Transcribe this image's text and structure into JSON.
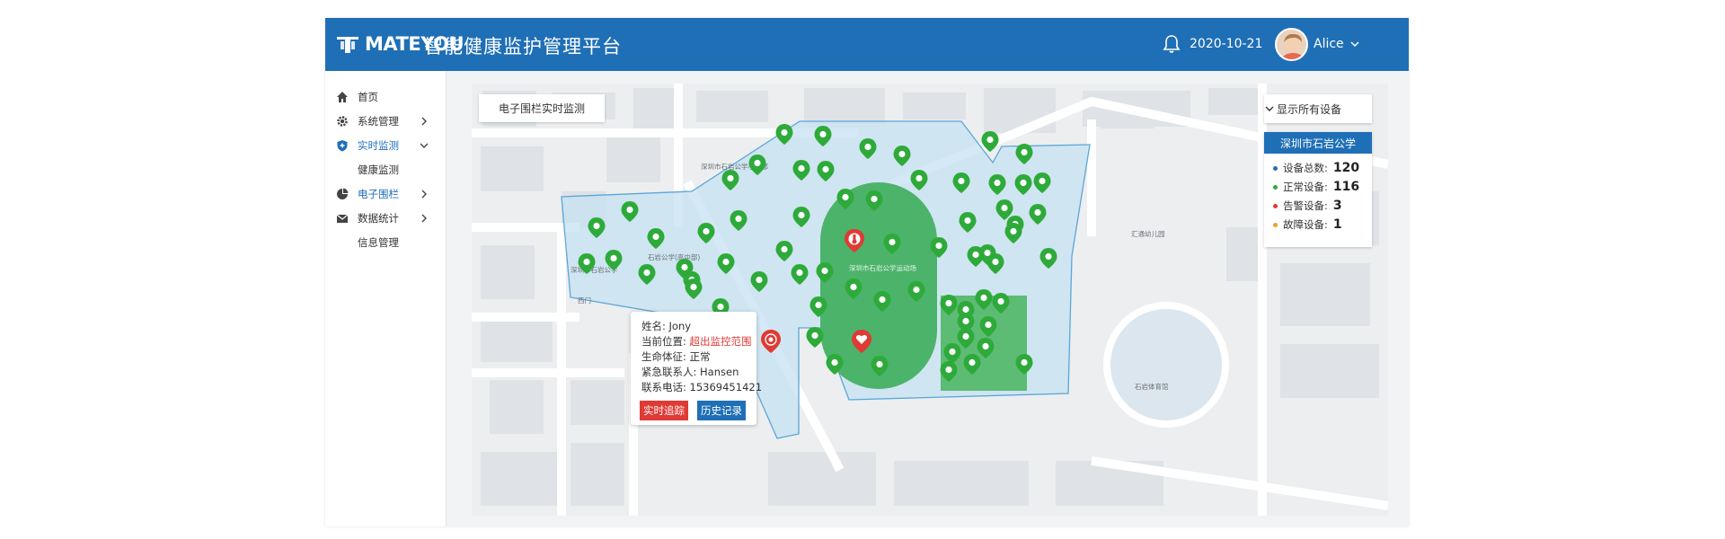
{
  "header": {
    "logo_text": "MATEYOU",
    "title": "智能健康监护管理平台",
    "date": "2020-10-21",
    "username": "Alice"
  },
  "sidebar": {
    "items": [
      {
        "label": "首页",
        "icon": "home-icon"
      },
      {
        "label": "系统管理",
        "icon": "gear-icon"
      },
      {
        "label": "实时监测",
        "icon": "shield-icon"
      },
      {
        "label": "健康监测"
      },
      {
        "label": "电子围栏",
        "icon": "pie-chart-icon"
      },
      {
        "label": "数据统计",
        "icon": "mail-icon"
      },
      {
        "label": "信息管理"
      }
    ]
  },
  "map": {
    "label": "电子围栏实时监测",
    "device_filter": "显示所有设备",
    "area_name": "深圳市石岩公学",
    "stats": [
      {
        "label": "设备总数:",
        "value": "120",
        "color": "#1f6fb7"
      },
      {
        "label": "正常设备:",
        "value": "116",
        "color": "#2eaa3a"
      },
      {
        "label": "告警设备:",
        "value": "3",
        "color": "#e03a35"
      },
      {
        "label": "故障设备:",
        "value": "1",
        "color": "#f0a020"
      }
    ],
    "place_labels": [
      "深圳市石岩公学",
      "深圳市石岩公学幼儿园",
      "石岩公学(高中部)",
      "深圳市石岩公学小学部",
      "石岩体育馆",
      "西门",
      "汇通幼儿园",
      "深圳市石岩公学运动场"
    ]
  },
  "popup": {
    "name_label": "姓名:",
    "name": "Jony",
    "location_label": "当前位置:",
    "location": "超出监控范围",
    "vital_label": "生命体征:",
    "vital": "正常",
    "contact_label": "紧急联系人:",
    "contact": "Hansen",
    "phone_label": "联系电话:",
    "phone": "15369451421",
    "track_button": "实时追踪",
    "history_button": "历史记录"
  },
  "colors": {
    "brand": "#1f6fb7",
    "normal": "#2eaa3a",
    "alarm": "#e03a35",
    "fault": "#f0a020"
  }
}
